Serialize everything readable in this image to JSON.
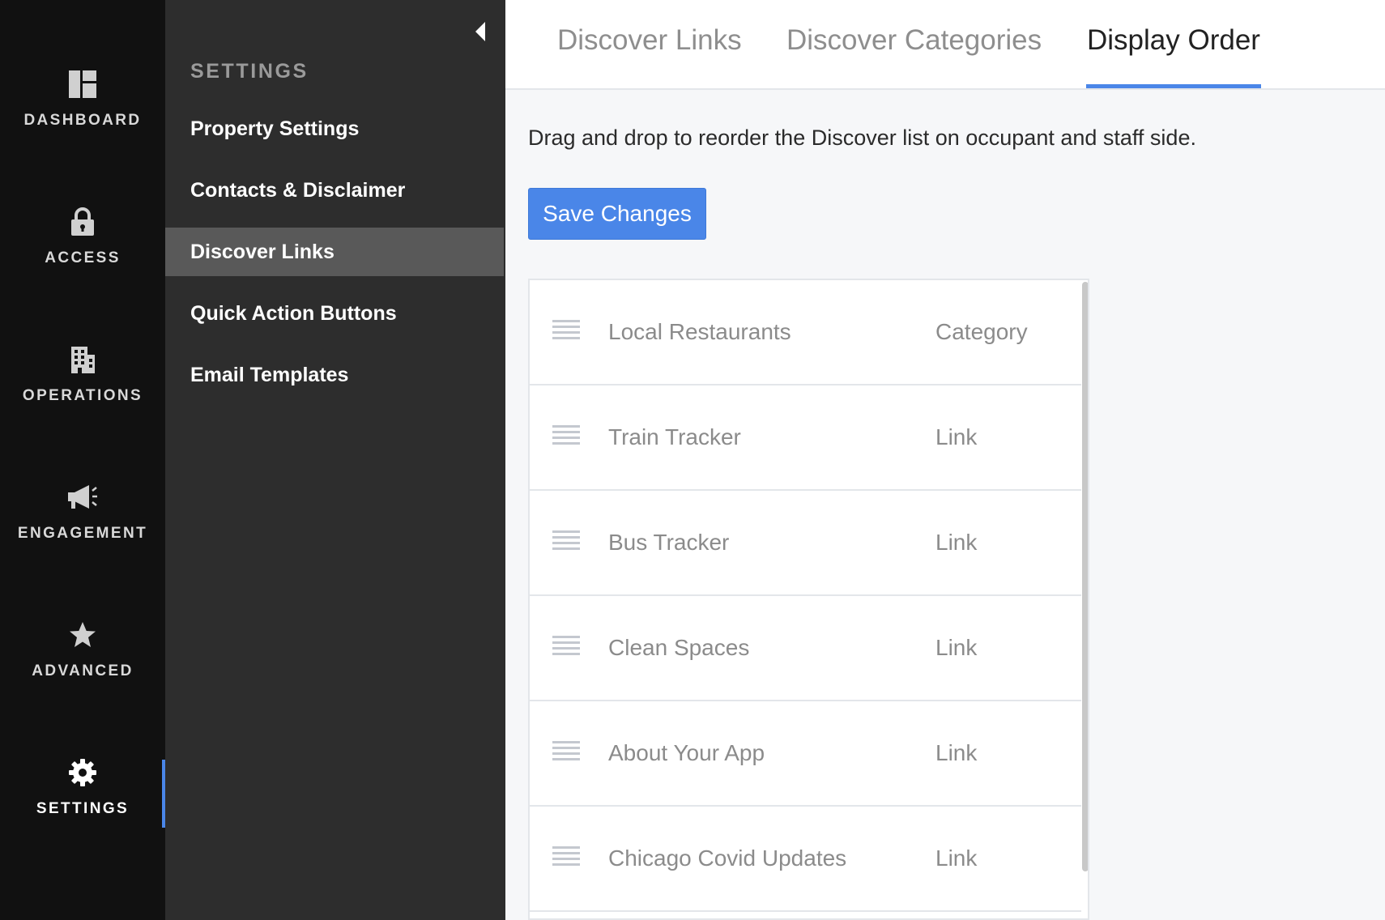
{
  "rail": {
    "items": [
      {
        "label": "DASHBOARD",
        "icon": "dashboard-icon"
      },
      {
        "label": "ACCESS",
        "icon": "lock-icon"
      },
      {
        "label": "OPERATIONS",
        "icon": "building-icon"
      },
      {
        "label": "ENGAGEMENT",
        "icon": "megaphone-icon"
      },
      {
        "label": "ADVANCED",
        "icon": "star-icon"
      },
      {
        "label": "SETTINGS",
        "icon": "gear-icon"
      }
    ],
    "active": "SETTINGS"
  },
  "subnav": {
    "heading": "SETTINGS",
    "items": [
      {
        "label": "Property Settings"
      },
      {
        "label": "Contacts & Disclaimer"
      },
      {
        "label": "Discover Links"
      },
      {
        "label": "Quick Action Buttons"
      },
      {
        "label": "Email Templates"
      }
    ],
    "active": "Discover Links",
    "collapse_icon": "caret-left-icon"
  },
  "tabs": [
    {
      "label": "Discover Links"
    },
    {
      "label": "Discover Categories"
    },
    {
      "label": "Display Order"
    }
  ],
  "active_tab": "Display Order",
  "main": {
    "instruction": "Drag and drop to reorder the Discover list on occupant and staff side.",
    "save_label": "Save Changes"
  },
  "list": {
    "rows": [
      {
        "name": "Local Restaurants",
        "type": "Category"
      },
      {
        "name": "Train Tracker",
        "type": "Link"
      },
      {
        "name": "Bus Tracker",
        "type": "Link"
      },
      {
        "name": "Clean Spaces",
        "type": "Link"
      },
      {
        "name": "About Your App",
        "type": "Link"
      },
      {
        "name": "Chicago Covid Updates",
        "type": "Link"
      }
    ]
  },
  "colors": {
    "accent": "#4a86e8",
    "rail_bg": "#111111",
    "subnav_bg": "#2d2d2d",
    "subnav_active_bg": "#595959",
    "main_bg": "#f6f7f9"
  }
}
